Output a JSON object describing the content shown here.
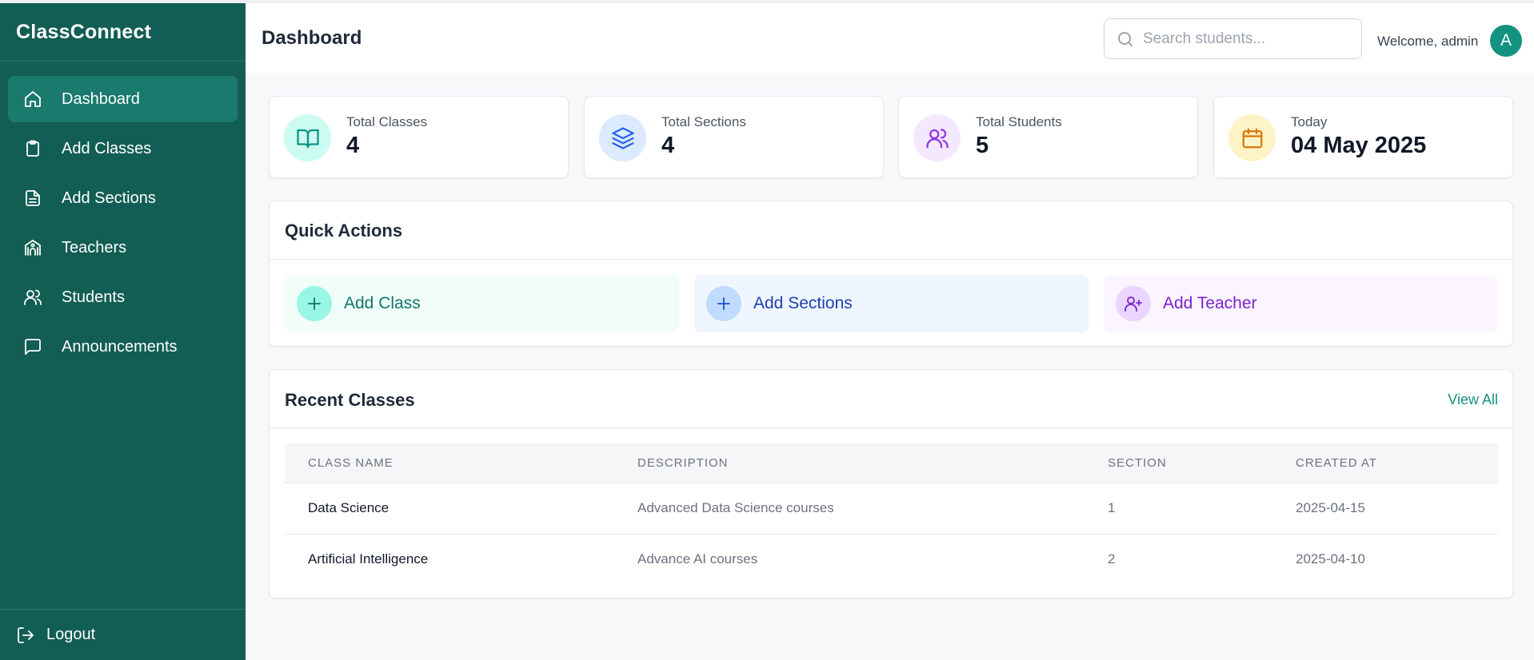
{
  "app": {
    "title": "ClassConnect"
  },
  "sidebar": {
    "items": [
      {
        "label": "Dashboard",
        "icon": "home-icon"
      },
      {
        "label": "Add Classes",
        "icon": "clipboard-icon"
      },
      {
        "label": "Add Sections",
        "icon": "file-text-icon"
      },
      {
        "label": "Teachers",
        "icon": "school-icon"
      },
      {
        "label": "Students",
        "icon": "users-icon"
      },
      {
        "label": "Announcements",
        "icon": "message-square-icon"
      }
    ],
    "logout_label": "Logout"
  },
  "header": {
    "title": "Dashboard",
    "search_placeholder": "Search students...",
    "welcome": "Welcome, admin",
    "avatar_initial": "A"
  },
  "stats": [
    {
      "label": "Total Classes",
      "value": "4",
      "icon": "book-open-icon",
      "color": "#0d9488",
      "bg": "#ccfbf1"
    },
    {
      "label": "Total Sections",
      "value": "4",
      "icon": "layers-icon",
      "color": "#2563eb",
      "bg": "#dbeafe"
    },
    {
      "label": "Total Students",
      "value": "5",
      "icon": "users-icon",
      "color": "#9333ea",
      "bg": "#f3e8ff"
    },
    {
      "label": "Today",
      "value": "04 May 2025",
      "icon": "calendar-icon",
      "color": "#d97706",
      "bg": "#fef3c7"
    }
  ],
  "quick_actions": {
    "title": "Quick Actions",
    "items": [
      {
        "label": "Add Class",
        "icon": "plus-icon"
      },
      {
        "label": "Add Sections",
        "icon": "plus-icon"
      },
      {
        "label": "Add Teacher",
        "icon": "user-plus-icon"
      }
    ]
  },
  "recent_classes": {
    "title": "Recent Classes",
    "view_all": "View All",
    "columns": [
      "CLASS NAME",
      "DESCRIPTION",
      "SECTION",
      "CREATED AT"
    ],
    "rows": [
      {
        "name": "Data Science",
        "description": "Advanced Data Science courses",
        "section": "1",
        "created_at": "2025-04-15"
      },
      {
        "name": "Artificial Intelligence",
        "description": "Advance AI courses",
        "section": "2",
        "created_at": "2025-04-10"
      }
    ]
  },
  "colors": {
    "sidebar_bg": "#125e54",
    "sidebar_active": "#1a7a6e",
    "accent": "#14917d"
  }
}
